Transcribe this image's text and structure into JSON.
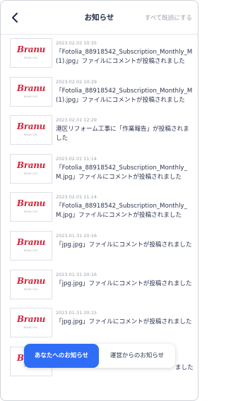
{
  "header": {
    "title": "お知らせ",
    "mark_all_read": "すべて既読にする",
    "back_icon": "chevron-left-icon"
  },
  "brand": {
    "logo_text": "Branu",
    "logo_sub": "BRANU INC.",
    "logo_color": "#d3253a"
  },
  "notifications": [
    {
      "timestamp": "2023.02.02 10:35",
      "message": "「Fotolia_88918542_Subscription_Monthly_M(1).jpg」ファイルにコメントが投稿されました"
    },
    {
      "timestamp": "2023.02.02 10:29",
      "message": "「Fotolia_88918542_Subscription_Monthly_M(1).jpg」ファイルにコメントが投稿されました"
    },
    {
      "timestamp": "2023.02.01 12:29",
      "message": "港区リフォーム工事に「作業報告」が投稿されました"
    },
    {
      "timestamp": "2023.02.01 11:14",
      "message": "「Fotolia_88918542_Subscription_Monthly_M.jpg」ファイルにコメントが投稿されました"
    },
    {
      "timestamp": "2023.02.01 11:14",
      "message": "「Fotolia_88918542_Subscription_Monthly_M.jpg」ファイルにコメントが投稿されました"
    },
    {
      "timestamp": "2023.01.31 20:16",
      "message": "「jpg.jpg」ファイルにコメントが投稿されました"
    },
    {
      "timestamp": "2023.01.31 20:16",
      "message": "「jpg.jpg」ファイルにコメントが投稿されました"
    },
    {
      "timestamp": "2023.01.31 20:15",
      "message": "「jpg.jpg」ファイルにコメントが投稿されました"
    },
    {
      "timestamp": "",
      "message": "ました"
    }
  ],
  "tabs": {
    "active_label": "あなたへのお知らせ",
    "other_label": "運営からのお知らせ",
    "active_color": "#2f6df6"
  }
}
